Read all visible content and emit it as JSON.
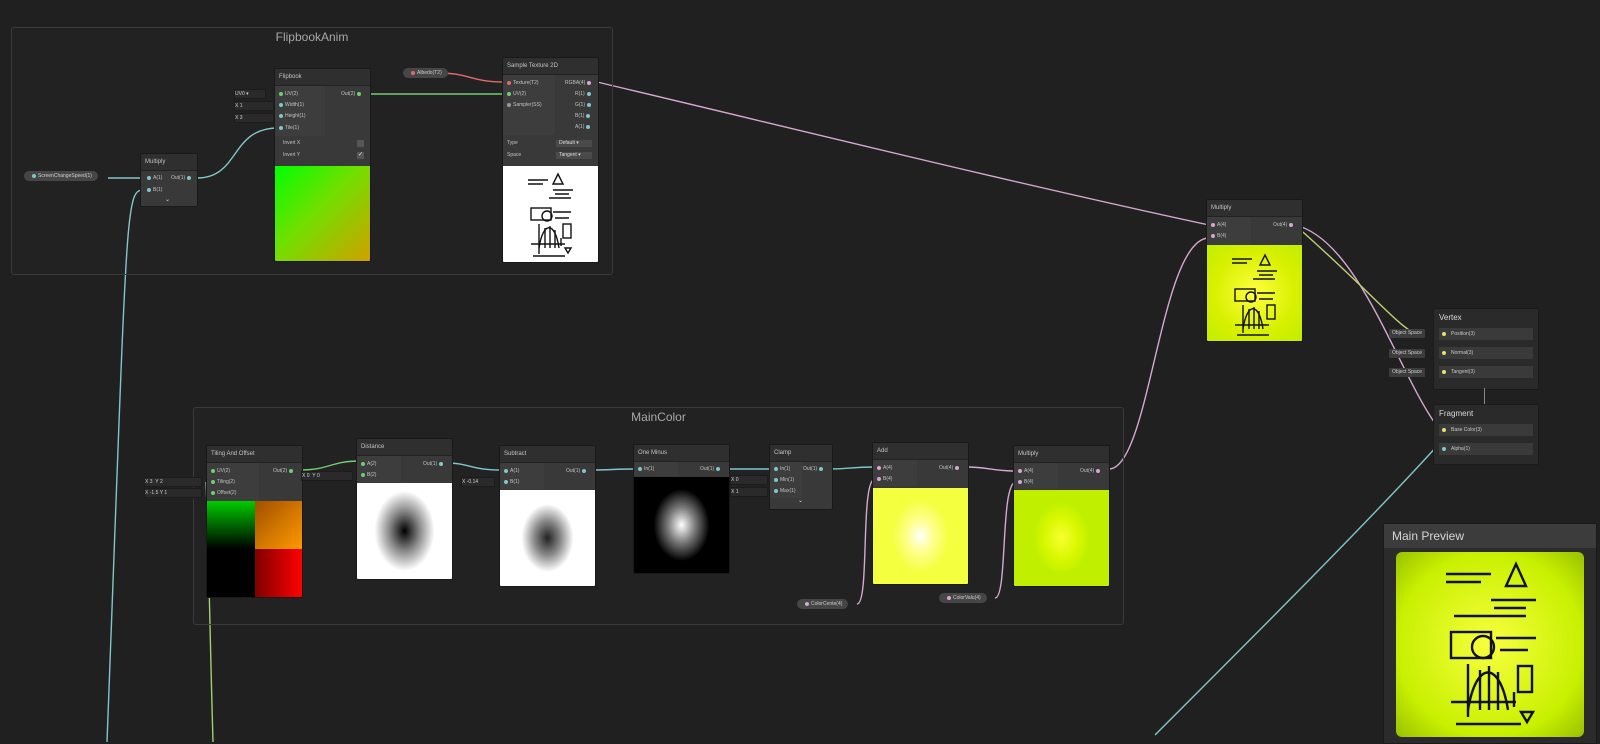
{
  "groups": {
    "flipbook": "FlipbookAnim",
    "maincolor": "MainColor"
  },
  "properties": {
    "screen_change_speed": "ScreenChangeSpeed(1)",
    "albedo": "Albedo(T2)",
    "color_center": "ColorCente(4)",
    "color_value": "ColorValu(4)"
  },
  "nodes": {
    "multiply_small": {
      "title": "Multiply",
      "in_a": "A(1)",
      "in_b": "B(1)",
      "out": "Out(1)"
    },
    "flipbook": {
      "title": "Flipbook",
      "inputs": [
        "UV(2)",
        "Width(1)",
        "Height(1)",
        "Tile(1)"
      ],
      "out": "Out(2)",
      "uv_default": "UV0 ▾",
      "width_x": "X",
      "width_val": "1",
      "height_x": "X",
      "height_val": "3",
      "invert_x": "Invert X",
      "invert_y": "Invert Y",
      "checkmark": "✓"
    },
    "sample_texture": {
      "title": "Sample Texture 2D",
      "inputs": [
        "Texture(T2)",
        "UV(2)",
        "Sampler(SS)"
      ],
      "outputs": [
        "RGBA(4)",
        "R(1)",
        "G(1)",
        "B(1)",
        "A(1)"
      ],
      "type_label": "Type",
      "type_value": "Default ▾",
      "space_label": "Space",
      "space_value": "Tangent ▾"
    },
    "multiply_right": {
      "title": "Multiply",
      "in_a": "A(4)",
      "in_b": "B(4)",
      "out": "Out(4)"
    },
    "tiling_offset": {
      "title": "Tiling And Offset",
      "inputs": [
        "UV(2)",
        "Tiling(2)",
        "Offset(2)"
      ],
      "out": "Out(2)",
      "tiling_x": "X",
      "tiling_x_val": "3",
      "tiling_y": "Y",
      "tiling_y_val": "2",
      "offset_x": "X",
      "offset_x_val": "-1.5",
      "offset_y": "Y",
      "offset_y_val": "1"
    },
    "distance": {
      "title": "Distance",
      "inputs": [
        "A(2)",
        "B(2)"
      ],
      "out": "Out(1)",
      "b_x": "X",
      "b_x_val": "0",
      "b_y": "Y",
      "b_y_val": "0"
    },
    "subtract": {
      "title": "Subtract",
      "inputs": [
        "A(1)",
        "B(1)"
      ],
      "out": "Out(1)",
      "b_x": "X",
      "b_x_val": "-0.14"
    },
    "one_minus": {
      "title": "One Minus",
      "inputs": [
        "In(1)"
      ],
      "out": "Out(1)"
    },
    "clamp": {
      "title": "Clamp",
      "inputs": [
        "In(1)",
        "Min(1)",
        "Max(1)"
      ],
      "out": "Out(1)",
      "min_x": "X",
      "min_val": "0",
      "max_x": "X",
      "max_val": "1"
    },
    "add": {
      "title": "Add",
      "inputs": [
        "A(4)",
        "B(4)"
      ],
      "out": "Out(4)"
    },
    "multiply_color": {
      "title": "Multiply",
      "inputs": [
        "A(4)",
        "B(4)"
      ],
      "out": "Out(4)"
    }
  },
  "master": {
    "vertex_title": "Vertex",
    "vertex_slots": [
      "Position(3)",
      "Normal(3)",
      "Tangent(3)"
    ],
    "space_tag": "Object Space",
    "fragment_title": "Fragment",
    "fragment_slots": [
      "Base Color(3)",
      "Alpha(1)"
    ]
  },
  "main_preview": {
    "title": "Main Preview"
  },
  "colors": {
    "background": "#202020",
    "wire_uv": "#6fcf6f",
    "wire_float": "#7fc7c9",
    "wire_vec4": "#d6a7d0",
    "wire_texture": "#e06a6a",
    "lime": "#c8f000"
  }
}
